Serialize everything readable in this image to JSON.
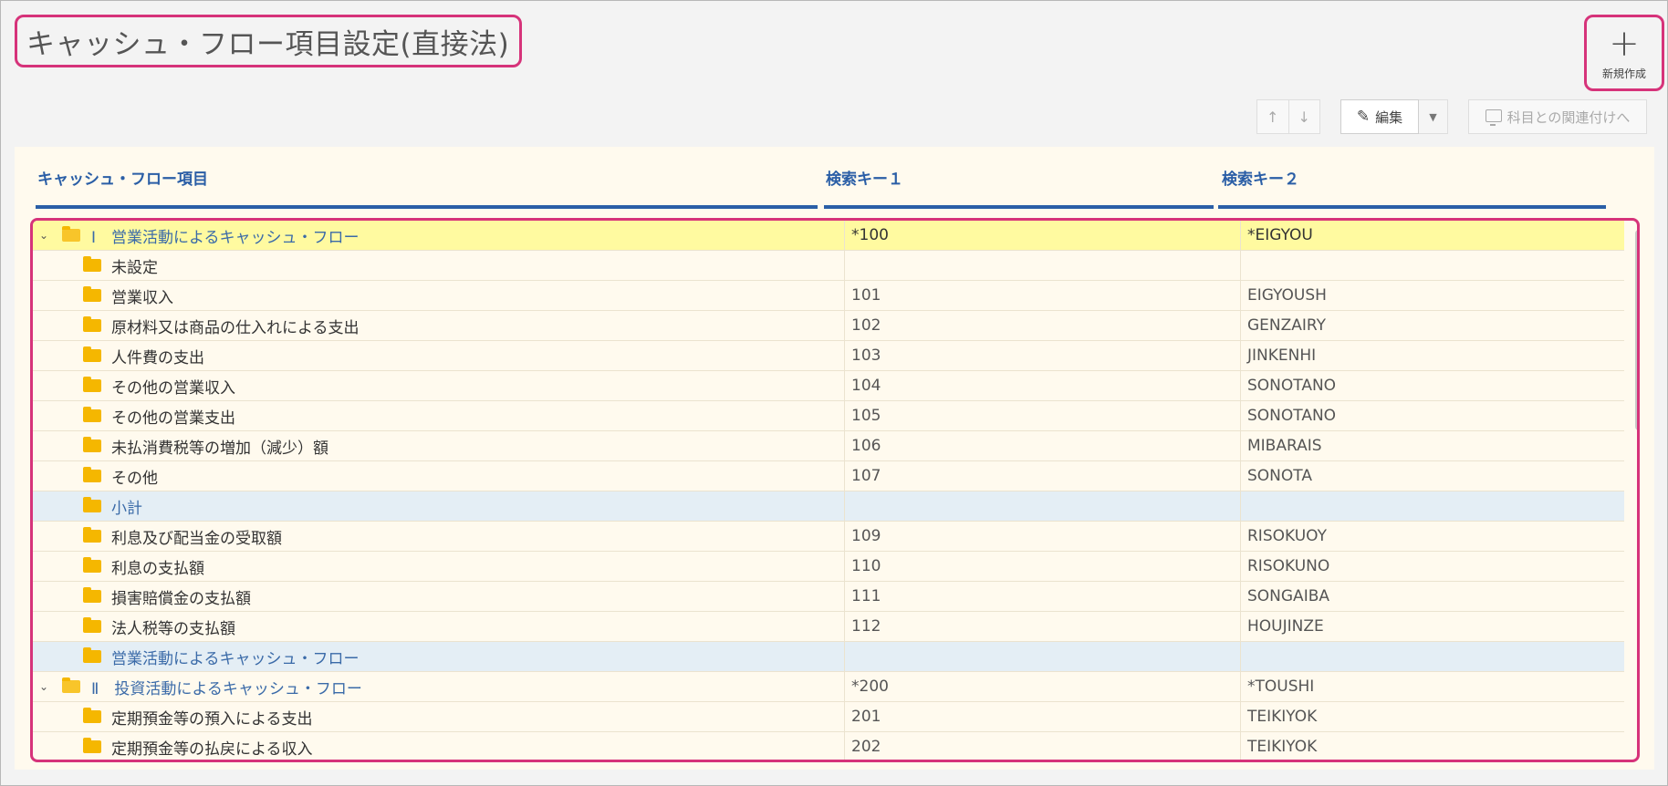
{
  "page": {
    "title": "キャッシュ・フロー項目設定(直接法)",
    "new_button_label": "新規作成"
  },
  "toolbar": {
    "up_arrow": "↑",
    "down_arrow": "↓",
    "edit_label": "編集",
    "link_label": "科目との関連付けへ"
  },
  "table": {
    "columns": [
      "キャッシュ・フロー項目",
      "検索キー１",
      "検索キー２"
    ],
    "rows": [
      {
        "name": "Ⅰ　営業活動によるキャッシュ・フロー",
        "key1": "*100",
        "key2": "*EIGYOU"
      },
      {
        "name": "未設定",
        "key1": "",
        "key2": ""
      },
      {
        "name": "営業収入",
        "key1": "101",
        "key2": "EIGYOUSH"
      },
      {
        "name": "原材料又は商品の仕入れによる支出",
        "key1": "102",
        "key2": "GENZAIRY"
      },
      {
        "name": "人件費の支出",
        "key1": "103",
        "key2": "JINKENHI"
      },
      {
        "name": "その他の営業収入",
        "key1": "104",
        "key2": "SONOTANO"
      },
      {
        "name": "その他の営業支出",
        "key1": "105",
        "key2": "SONOTANO"
      },
      {
        "name": "未払消費税等の増加（減少）額",
        "key1": "106",
        "key2": "MIBARAIS"
      },
      {
        "name": "その他",
        "key1": "107",
        "key2": "SONOTA"
      },
      {
        "name": "小計",
        "key1": "",
        "key2": ""
      },
      {
        "name": "利息及び配当金の受取額",
        "key1": "109",
        "key2": "RISOKUOY"
      },
      {
        "name": "利息の支払額",
        "key1": "110",
        "key2": "RISOKUNO"
      },
      {
        "name": "損害賠償金の支払額",
        "key1": "111",
        "key2": "SONGAIBA"
      },
      {
        "name": "法人税等の支払額",
        "key1": "112",
        "key2": "HOUJINZE"
      },
      {
        "name": "営業活動によるキャッシュ・フロー",
        "key1": "",
        "key2": ""
      },
      {
        "name": "Ⅱ　投資活動によるキャッシュ・フロー",
        "key1": "*200",
        "key2": "*TOUSHI"
      },
      {
        "name": "定期預金等の預入による支出",
        "key1": "201",
        "key2": "TEIKIYOK"
      },
      {
        "name": "定期預金等の払戻による収入",
        "key1": "202",
        "key2": "TEIKIYOK"
      }
    ]
  },
  "colors": {
    "accent_highlight": "#d6337a",
    "header_blue": "#2a5ea6",
    "selected_row": "#fffaa0",
    "subtotal_row": "#e4eef5",
    "folder": "#f5b700"
  }
}
